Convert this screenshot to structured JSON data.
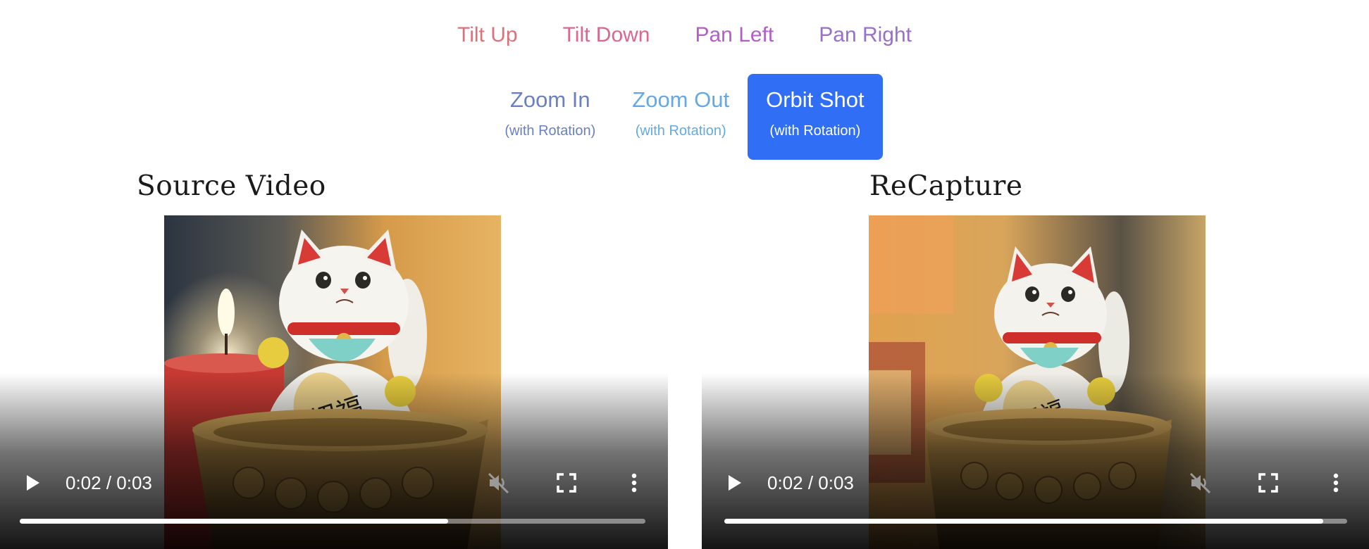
{
  "camera_controls": {
    "row1": [
      {
        "label": "Tilt Up",
        "color": "#d9737a"
      },
      {
        "label": "Tilt Down",
        "color": "#d9678f"
      },
      {
        "label": "Pan Left",
        "color": "#b05fc4"
      },
      {
        "label": "Pan Right",
        "color": "#9770c9"
      }
    ],
    "row2": [
      {
        "label": "Zoom In",
        "sublabel": "(with Rotation)",
        "color": "#6b7fc4"
      },
      {
        "label": "Zoom Out",
        "sublabel": "(with Rotation)",
        "color": "#63a9e6"
      },
      {
        "label": "Orbit Shot",
        "sublabel": "(with Rotation)",
        "color": "#ffffff",
        "active": true
      }
    ],
    "active_color": "#2f6ef5"
  },
  "source": {
    "title": "Source Video",
    "player": {
      "time": "0:02 / 0:03",
      "progress": 0.685,
      "muted": true,
      "icons": [
        "play-icon",
        "muted-speaker-icon",
        "fullscreen-icon",
        "more-vert-icon"
      ]
    }
  },
  "recapture": {
    "title": "ReCapture",
    "player": {
      "time": "0:02 / 0:03",
      "progress": 0.962,
      "muted": true,
      "icons": [
        "play-icon",
        "muted-speaker-icon",
        "fullscreen-icon",
        "more-vert-icon"
      ]
    }
  }
}
